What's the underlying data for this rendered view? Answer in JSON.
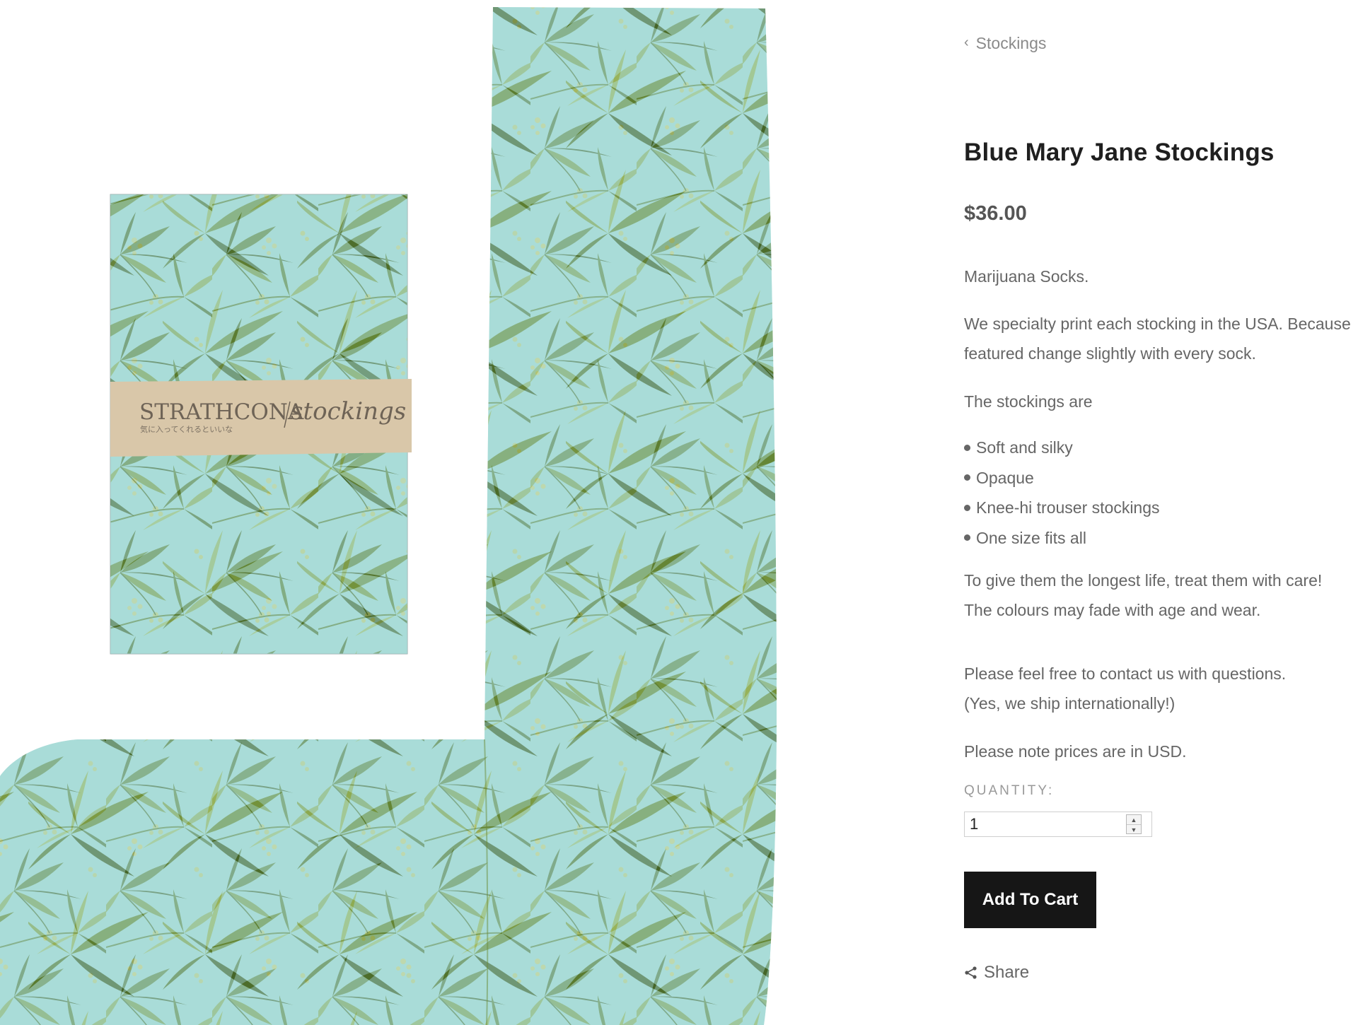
{
  "product_image": {
    "label_brand": "STRATHCONA",
    "label_script": "stockings",
    "label_japanese": "気に入ってくれるといいな"
  },
  "breadcrumb": {
    "label": "Stockings"
  },
  "product": {
    "title": "Blue Mary Jane Stockings",
    "price": "$36.00"
  },
  "description": {
    "intro": "Marijuana Socks.",
    "print_line1": "We specialty print each stocking in the USA. Because",
    "print_line2": "featured change slightly with every sock.",
    "list_intro": "The stockings are",
    "features": [
      "Soft and silky",
      "Opaque",
      "Knee-hi trouser stockings",
      "One size fits all"
    ],
    "care_line1": "To give them the longest life, treat them with care!",
    "care_line2": "The colours may fade with age and wear.",
    "contact_line1": "Please feel free to contact us with questions.",
    "contact_line2": "(Yes, we ship internationally!)",
    "currency_note": "Please note prices are in USD."
  },
  "purchase": {
    "quantity_label": "QUANTITY:",
    "quantity_value": "1",
    "add_to_cart_label": "Add To Cart",
    "share_label": "Share"
  },
  "colors": {
    "fabric": "#a9dcd8",
    "leaf_dark": "#4d6e2c",
    "leaf_light": "#93ad55",
    "button": "#161616"
  }
}
